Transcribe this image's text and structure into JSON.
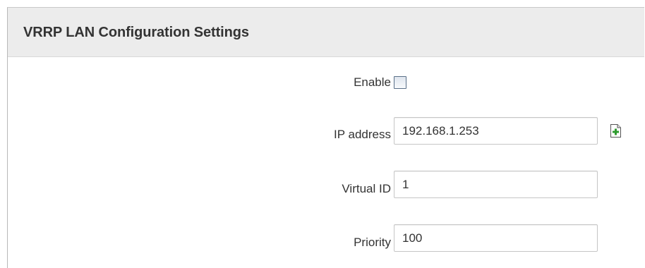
{
  "section": {
    "title": "VRRP LAN Configuration Settings"
  },
  "fields": {
    "enable": {
      "label": "Enable",
      "checked": false
    },
    "ip_address": {
      "label": "IP address",
      "value": "192.168.1.253"
    },
    "virtual_id": {
      "label": "Virtual ID",
      "value": "1"
    },
    "priority": {
      "label": "Priority",
      "value": "100"
    }
  },
  "icons": {
    "add_ip": "add-document-icon"
  },
  "colors": {
    "header_bg": "#ececec",
    "add_icon_green": "#2e9b2e"
  }
}
